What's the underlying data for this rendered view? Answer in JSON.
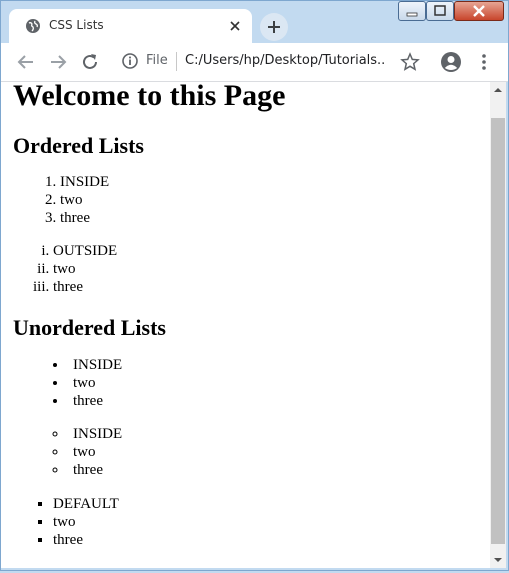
{
  "window": {
    "tab_title": "CSS Lists"
  },
  "toolbar": {
    "scheme_label": "File",
    "url": "C:/Users/hp/Desktop/Tutorials..."
  },
  "page": {
    "heading": "Welcome to this Page",
    "ordered_heading": "Ordered Lists",
    "ordered_inside_items": [
      "INSIDE",
      "two",
      "three"
    ],
    "ordered_outside_items": [
      "OUTSIDE",
      "two",
      "three"
    ],
    "unordered_heading": "Unordered Lists",
    "unordered_disc_items": [
      "INSIDE",
      "two",
      "three"
    ],
    "unordered_circle_items": [
      "INSIDE",
      "two",
      "three"
    ],
    "unordered_square_items": [
      "DEFAULT",
      "two",
      "three"
    ]
  },
  "icons": {
    "favicon": "globe-icon",
    "tab_close": "close-icon",
    "new_tab": "plus-icon",
    "back": "back-arrow-icon",
    "forward": "forward-arrow-icon",
    "reload": "reload-icon",
    "site_info": "info-icon",
    "bookmark": "star-icon",
    "profile": "account-icon",
    "menu": "more-vertical-icon"
  },
  "colors": {
    "frame": "#c2daf0",
    "tab": "#ffffff",
    "scroll_thumb": "#c1c1c1"
  }
}
